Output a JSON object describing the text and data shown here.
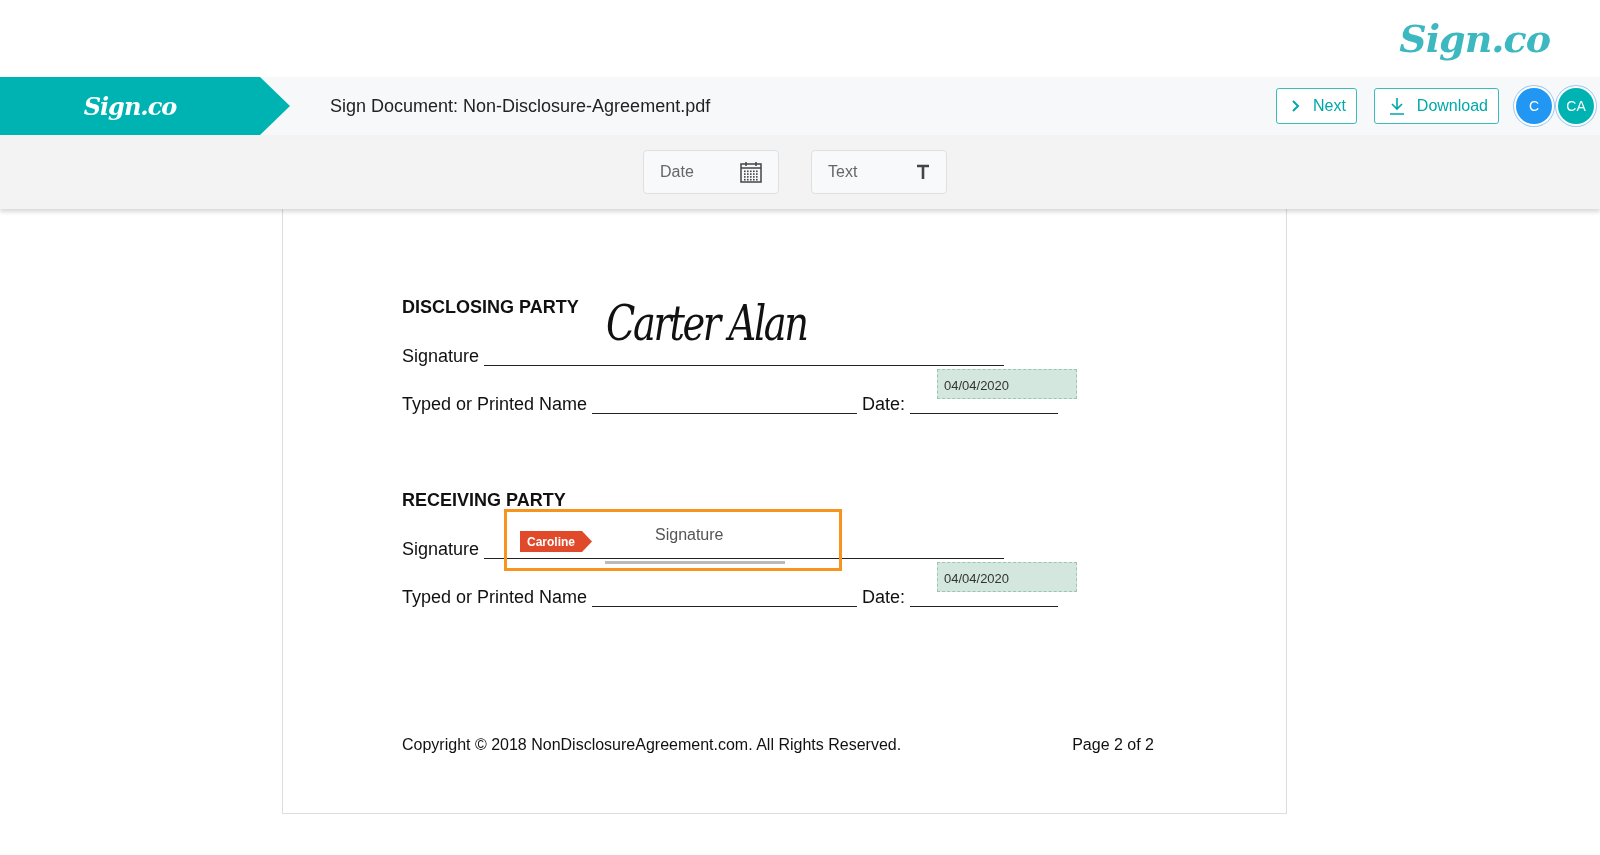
{
  "top_logo": "Sign.co",
  "header": {
    "logo": "Sign.co",
    "title": "Sign Document: Non-Disclosure-Agreement.pdf",
    "buttons": [
      {
        "kind": "next",
        "label": "Next"
      },
      {
        "kind": "download",
        "label": "Download"
      }
    ],
    "avatars": [
      {
        "initials": "C",
        "color": "#2196f3"
      },
      {
        "initials": "CA",
        "color": "#00b3b3"
      }
    ]
  },
  "toolbar": {
    "fields": [
      {
        "kind": "date",
        "label": "Date"
      },
      {
        "kind": "text",
        "label": "Text"
      }
    ]
  },
  "document": {
    "sections": [
      {
        "heading": "DISCLOSING PARTY",
        "signature_label": "Signature",
        "signature": {
          "kind": "signed",
          "text": "Carter Alan"
        },
        "name_label": "Typed or Printed Name",
        "date_label": "Date:",
        "date_value": "04/04/2020"
      },
      {
        "heading": "RECEIVING PARTY",
        "signature_label": "Signature",
        "signature": {
          "kind": "field",
          "signer": "Caroline",
          "placeholder": "Signature"
        },
        "name_label": "Typed or Printed Name",
        "date_label": "Date:",
        "date_value": "04/04/2020"
      }
    ],
    "footer": {
      "copyright": "Copyright © 2018 NonDisclosureAgreement.com. All Rights Reserved.",
      "page": "Page 2 of 2"
    }
  }
}
